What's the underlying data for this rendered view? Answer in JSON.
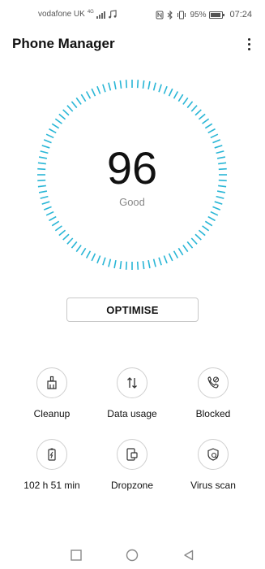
{
  "status_bar": {
    "carrier": "vodafone UK",
    "network": "4G",
    "battery": "95%",
    "battery_level": 0.95,
    "time": "07:24",
    "icons": [
      "signal-icon",
      "music-note-icon",
      "nfc-icon",
      "bluetooth-icon",
      "vibrate-icon",
      "battery-icon"
    ]
  },
  "app_bar": {
    "title": "Phone Manager",
    "menu_icon": "more-vertical-icon"
  },
  "gauge": {
    "score": "96",
    "status": "Good",
    "accent_color": "#29b6d6"
  },
  "optimise_label": "OPTIMISE",
  "tools": [
    {
      "label": "Cleanup",
      "icon": "broom-icon"
    },
    {
      "label": "Data usage",
      "icon": "data-arrows-icon"
    },
    {
      "label": "Blocked",
      "icon": "blocked-call-icon"
    },
    {
      "label": "102 h 51 min",
      "icon": "battery-charging-icon"
    },
    {
      "label": "Dropzone",
      "icon": "dropzone-icon"
    },
    {
      "label": "Virus scan",
      "icon": "shield-search-icon"
    }
  ],
  "nav_bar": {
    "recent_icon": "square-icon",
    "home_icon": "circle-icon",
    "back_icon": "triangle-back-icon"
  }
}
